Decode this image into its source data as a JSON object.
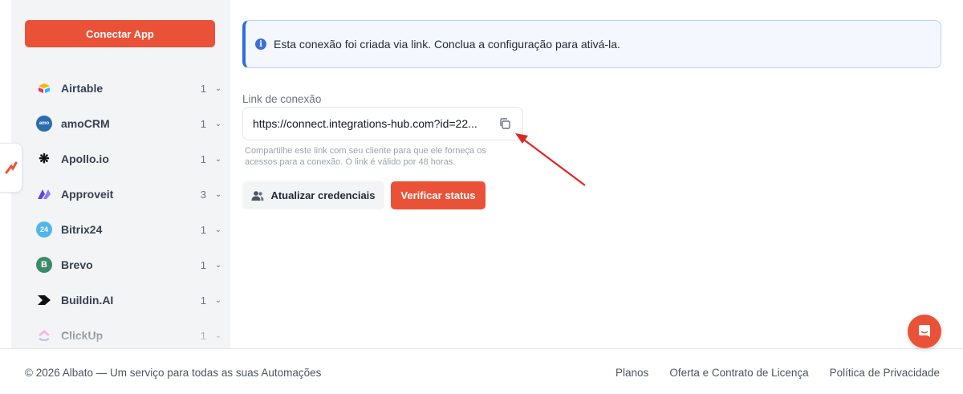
{
  "sidebar": {
    "connect_label": "Conectar App",
    "apps": [
      {
        "name": "Airtable",
        "count": "1",
        "icon": "airtable-logo-icon",
        "color": "#f5a623"
      },
      {
        "name": "amoCRM",
        "count": "1",
        "icon": "amocrm-logo-icon",
        "color": "#2b6cb0",
        "badge": "amo"
      },
      {
        "name": "Apollo.io",
        "count": "1",
        "icon": "apollo-logo-icon",
        "color": "#111111"
      },
      {
        "name": "Approveit",
        "count": "3",
        "icon": "approveit-logo-icon",
        "color": "#5b4bd6"
      },
      {
        "name": "Bitrix24",
        "count": "1",
        "icon": "bitrix24-logo-icon",
        "color": "#4fb7ea",
        "badge": "24"
      },
      {
        "name": "Brevo",
        "count": "1",
        "icon": "brevo-logo-icon",
        "color": "#3d8a6a",
        "badge": "B"
      },
      {
        "name": "Buildin.AI",
        "count": "1",
        "icon": "buildin-logo-icon",
        "color": "#111111"
      },
      {
        "name": "ClickUp",
        "count": "1",
        "icon": "clickup-logo-icon",
        "color": "#7b68ee"
      }
    ]
  },
  "info": {
    "text": "Esta conexão foi criada via link. Conclua a configuração para ativá-la.",
    "icon": "info-icon"
  },
  "link": {
    "label": "Link de conexão",
    "value": "https://connect.integrations-hub.com?id=22...",
    "hint": "Compartilhe este link com seu cliente para que ele forneça os acessos para a conexão. O link é válido por 48 horas."
  },
  "actions": {
    "update_label": "Atualizar credenciais",
    "verify_label": "Verificar status"
  },
  "footer": {
    "copyright": "© 2026 Albato — Um serviço para todas as suas Automações",
    "links": [
      "Planos",
      "Oferta e Contrato de Licença",
      "Política de Privacidade"
    ]
  },
  "colors": {
    "accent": "#ea5238",
    "info_border": "#2f6be0",
    "annotation_arrow": "#e02424"
  }
}
